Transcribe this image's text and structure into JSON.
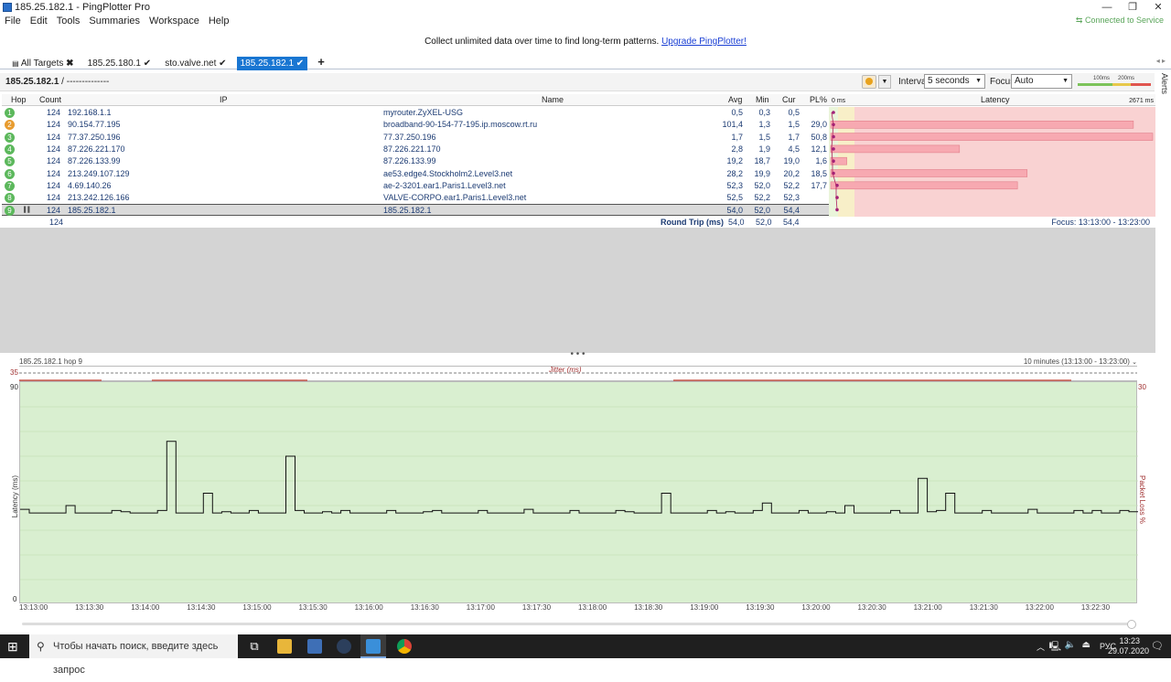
{
  "window": {
    "title": "185.25.182.1 - PingPlotter Pro"
  },
  "menu": [
    "File",
    "Edit",
    "Tools",
    "Summaries",
    "Workspace",
    "Help"
  ],
  "connection_status": "Connected to Service",
  "banner": {
    "text": "Collect unlimited data over time to find long-term patterns.",
    "link": "Upgrade PingPlotter!"
  },
  "tabs": [
    {
      "label": "All Targets"
    },
    {
      "label": "185.25.180.1"
    },
    {
      "label": "sto.valve.net"
    },
    {
      "label": "185.25.182.1"
    }
  ],
  "toolbar": {
    "target": "185.25.182.1",
    "separator": "/",
    "sub": "--------------",
    "interval_label": "Interval",
    "interval_value": "5 seconds",
    "focus_label": "Focus",
    "focus_value": "Auto",
    "scale_100": "100ms",
    "scale_200": "200ms"
  },
  "alerts_label": "Alerts",
  "table": {
    "headers": {
      "hop": "Hop",
      "count": "Count",
      "ip": "IP",
      "name": "Name",
      "avg": "Avg",
      "min": "Min",
      "cur": "Cur",
      "pl": "PL%",
      "latency": "Latency"
    },
    "latency_min_label": "0 ms",
    "latency_max_label": "2671 ms",
    "rows": [
      {
        "hop": "1",
        "count": "124",
        "ip": "192.168.1.1",
        "name": "myrouter.ZyXEL-USG",
        "avg": "0,5",
        "min": "0,3",
        "cur": "0,5",
        "pl": "",
        "color": "#5cb85c",
        "pl_frac": 0
      },
      {
        "hop": "2",
        "count": "124",
        "ip": "90.154.77.195",
        "name": "broadband-90-154-77-195.ip.moscow.rt.ru",
        "avg": "101,4",
        "min": "1,3",
        "cur": "1,5",
        "pl": "29,0",
        "color": "#e89c2f",
        "pl_frac": 0.94
      },
      {
        "hop": "3",
        "count": "124",
        "ip": "77.37.250.196",
        "name": "77.37.250.196",
        "avg": "1,7",
        "min": "1,5",
        "cur": "1,7",
        "pl": "50,8",
        "color": "#5cb85c",
        "pl_frac": 1.0
      },
      {
        "hop": "4",
        "count": "124",
        "ip": "87.226.221.170",
        "name": "87.226.221.170",
        "avg": "2,8",
        "min": "1,9",
        "cur": "4,5",
        "pl": "12,1",
        "color": "#5cb85c",
        "pl_frac": 0.4
      },
      {
        "hop": "5",
        "count": "124",
        "ip": "87.226.133.99",
        "name": "87.226.133.99",
        "avg": "19,2",
        "min": "18,7",
        "cur": "19,0",
        "pl": "1,6",
        "color": "#5cb85c",
        "pl_frac": 0.05
      },
      {
        "hop": "6",
        "count": "124",
        "ip": "213.249.107.129",
        "name": "ae53.edge4.Stockholm2.Level3.net",
        "avg": "28,2",
        "min": "19,9",
        "cur": "20,2",
        "pl": "18,5",
        "color": "#5cb85c",
        "pl_frac": 0.61
      },
      {
        "hop": "7",
        "count": "124",
        "ip": "4.69.140.26",
        "name": "ae-2-3201.ear1.Paris1.Level3.net",
        "avg": "52,3",
        "min": "52,0",
        "cur": "52,2",
        "pl": "17,7",
        "color": "#5cb85c",
        "pl_frac": 0.58
      },
      {
        "hop": "8",
        "count": "124",
        "ip": "213.242.126.166",
        "name": "VALVE-CORPO.ear1.Paris1.Level3.net",
        "avg": "52,5",
        "min": "52,2",
        "cur": "52,3",
        "pl": "",
        "color": "#5cb85c",
        "pl_frac": 0
      },
      {
        "hop": "9",
        "count": "124",
        "ip": "185.25.182.1",
        "name": "185.25.182.1",
        "avg": "54,0",
        "min": "52,0",
        "cur": "54,4",
        "pl": "",
        "color": "#5cb85c",
        "pl_frac": 0
      }
    ],
    "summary": {
      "count": "124",
      "label": "Round Trip (ms)",
      "avg": "54,0",
      "min": "52,0",
      "cur": "54,4",
      "focus": "Focus: 13:13:00 - 13:23:00"
    }
  },
  "timeline": {
    "info_left": "185.25.182.1 hop 9",
    "info_right": "10 minutes (13:13:00 - 13:23:00)",
    "jitter_label": "Jitter (ms)",
    "jitter_max": "35",
    "y_max": "90",
    "y_min": "0",
    "pl_max": "30",
    "y_label": "Latency (ms)",
    "pl_label": "Packet Loss %",
    "x_ticks": [
      "13:13:00",
      "13:13:30",
      "13:14:00",
      "13:14:30",
      "13:15:00",
      "13:15:30",
      "13:16:00",
      "13:16:30",
      "13:17:00",
      "13:17:30",
      "13:18:00",
      "13:18:30",
      "13:19:00",
      "13:19:30",
      "13:20:00",
      "13:20:30",
      "13:21:00",
      "13:21:30",
      "13:22:00",
      "13:22:30"
    ]
  },
  "taskbar": {
    "search_placeholder": "Чтобы начать поиск, введите здесь запрос",
    "tray_lang": "РУС",
    "time": "13:23",
    "date": "29.07.2020"
  }
}
